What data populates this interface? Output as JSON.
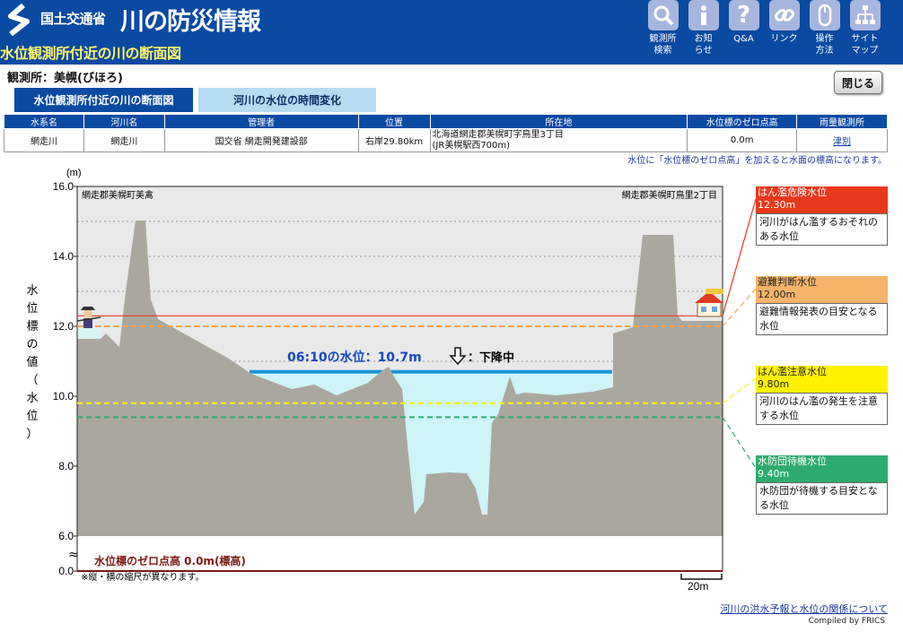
{
  "header": {
    "ministry": "国土交通省",
    "site_title": "川の防災情報",
    "page_heading": "水位観測所付近の川の断面図",
    "nav": [
      {
        "label": "観測所\n検索",
        "icon": "search-icon"
      },
      {
        "label": "お知\nらせ",
        "icon": "info-icon"
      },
      {
        "label": "Q&A",
        "icon": "question-icon"
      },
      {
        "label": "リンク",
        "icon": "link-icon"
      },
      {
        "label": "操作\n方法",
        "icon": "mouse-icon"
      },
      {
        "label": "サイト\nマップ",
        "icon": "sitemap-icon"
      }
    ]
  },
  "station_label": "観測所：美幌(びほろ)",
  "close_label": "閉じる",
  "tabs": [
    "水位観測所付近の川の断面図",
    "河川の水位の時間変化"
  ],
  "table": {
    "headers": [
      "水系名",
      "河川名",
      "管理者",
      "位置",
      "所在地",
      "水位標のゼロ点高",
      "雨量観測所"
    ],
    "row": {
      "system": "網走川",
      "river": "網走川",
      "manager": "国交省 網走開発建設部",
      "position": "右岸29.80km",
      "address1": "北海道網走郡美幌町字鳥里3丁目",
      "address2": "(JR美幌駅西700m)",
      "zero_height": "0.0m",
      "rain_station": "津別"
    }
  },
  "note": "水位に「水位標のゼロ点高」を加えると水面の標高になります。",
  "chart": {
    "unit": "(m)",
    "ylabel_chars": [
      "水",
      "位",
      "標",
      "の",
      "値",
      "（",
      "水",
      "位",
      "）"
    ],
    "yticks": [
      "16.0",
      "14.0",
      "12.0",
      "10.0",
      "8.0",
      "6.0",
      "0.0"
    ],
    "left_place": "網走郡美幌町美禽",
    "right_place": "網走郡美幌町鳥里2丁目",
    "current_level": "06:10の水位：10.7m",
    "trend": "：下降中",
    "zero_label": "水位標のゼロ点高 0.0m(標高)",
    "scale_note": "※縦・横の縮尺が異なります。",
    "scale_bar": "20m",
    "current_value": 10.7
  },
  "levels": [
    {
      "name": "はん濫危険水位",
      "value": "12.30m",
      "desc": "河川がはん濫するおそれのある水位",
      "color": "#e8391c",
      "level": 12.3
    },
    {
      "name": "避難判断水位",
      "value": "12.00m",
      "desc": "避難情報発表の目安となる水位",
      "color": "#f7a24d",
      "level": 12.0
    },
    {
      "name": "はん濫注意水位",
      "value": "9.80m",
      "desc": "河川のはん濫の発生を注意する水位",
      "color": "#fff200",
      "level": 9.8
    },
    {
      "name": "水防団待機水位",
      "value": "9.40m",
      "desc": "水防団が待機する目安となる水位",
      "color": "#2eab6e",
      "level": 9.4
    }
  ],
  "footer": {
    "link": "河川の洪水予報と水位の関係について",
    "compiled": "Compiled by FRICS"
  }
}
